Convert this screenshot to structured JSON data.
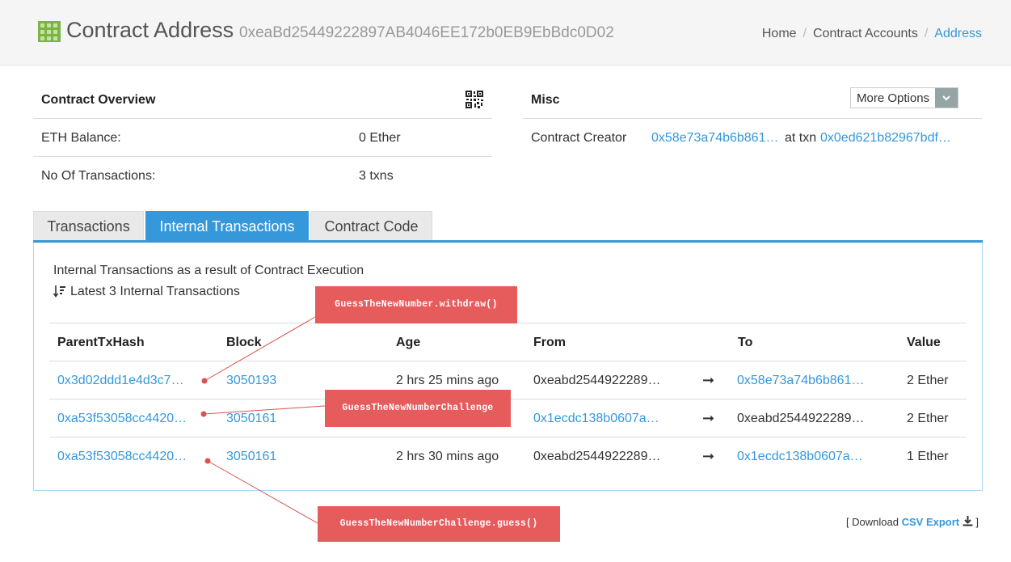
{
  "header": {
    "title": "Contract Address",
    "address": "0xeaBd25449222897AB4046EE172b0EB9EbBdc0D02",
    "breadcrumb": [
      "Home",
      "Contract Accounts",
      "Address"
    ]
  },
  "overview": {
    "title": "Contract Overview",
    "rows": [
      {
        "label": "ETH Balance:",
        "value": "0 Ether"
      },
      {
        "label": "No Of Transactions:",
        "value": "3 txns"
      }
    ]
  },
  "misc": {
    "title": "Misc",
    "more_options": "More Options",
    "creator_label": "Contract Creator",
    "creator_addr": "0x58e73a74b6b861…",
    "at_txn": "at txn",
    "creator_txn": "0x0ed621b82967bdf…"
  },
  "tabs": [
    "Transactions",
    "Internal Transactions",
    "Contract Code"
  ],
  "internal": {
    "heading": "Internal Transactions as a result of Contract Execution",
    "latest": "Latest 3 Internal Transactions",
    "columns": [
      "ParentTxHash",
      "Block",
      "Age",
      "From",
      "To",
      "Value"
    ],
    "rows": [
      {
        "hash": "0x3d02ddd1e4d3c7…",
        "block": "3050193",
        "age": "2 hrs 25 mins ago",
        "from": "0xeabd2544922289…",
        "to": "0x58e73a74b6b861…",
        "value": "2 Ether",
        "from_link": false,
        "to_link": true
      },
      {
        "hash": "0xa53f53058cc4420…",
        "block": "3050161",
        "age": "",
        "from": "0x1ecdc138b0607a…",
        "to": "0xeabd2544922289…",
        "value": "2 Ether",
        "from_link": true,
        "to_link": false
      },
      {
        "hash": "0xa53f53058cc4420…",
        "block": "3050161",
        "age": "2 hrs 30 mins ago",
        "from": "0xeabd2544922289…",
        "to": "0x1ecdc138b0607a…",
        "value": "1 Ether",
        "from_link": false,
        "to_link": true
      }
    ]
  },
  "annotations": [
    "GuessTheNewNumber.withdraw()",
    "GuessTheNewNumberChallenge",
    "GuessTheNewNumberChallenge.guess()"
  ],
  "footer": {
    "open": "[ Download",
    "link": "CSV Export",
    "close": "]"
  },
  "colors": {
    "accent": "#3498db",
    "annotation": "#e65b5c"
  }
}
